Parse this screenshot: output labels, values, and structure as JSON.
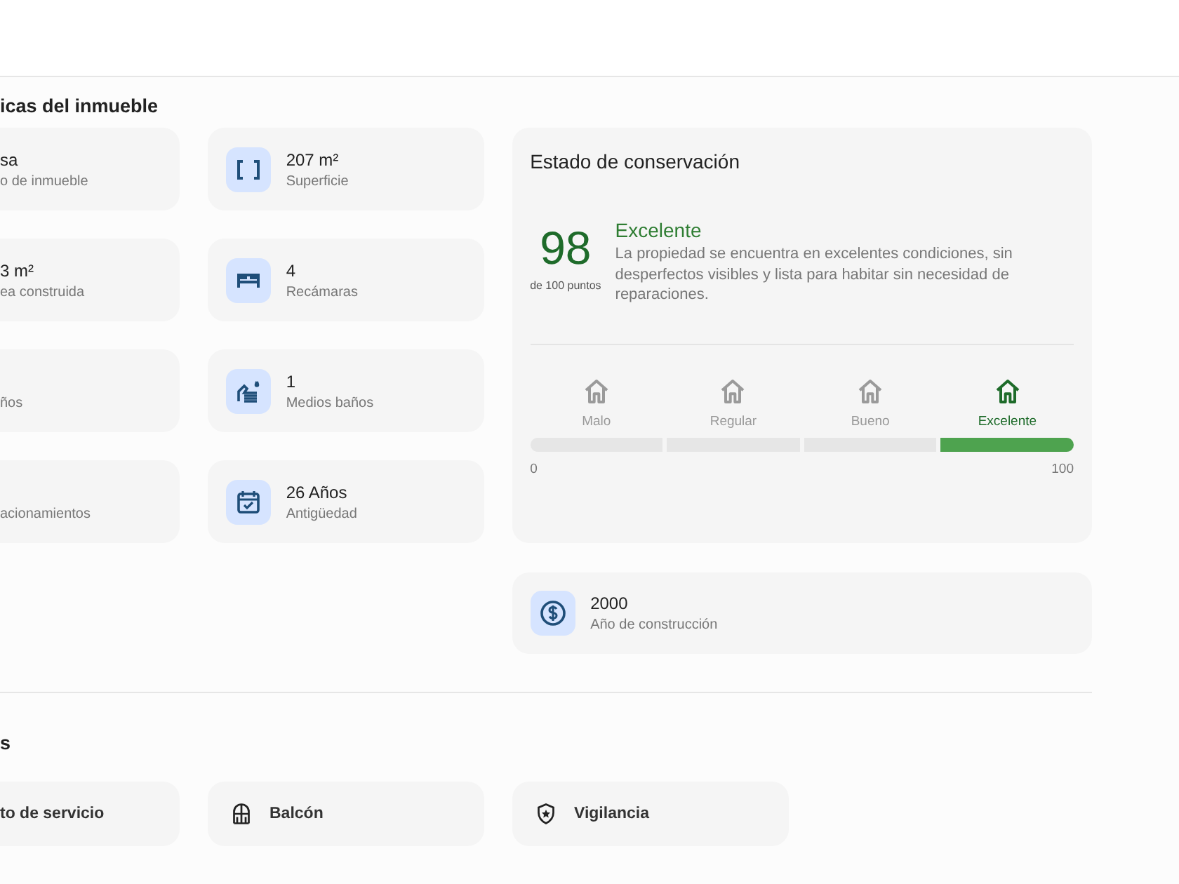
{
  "characteristics": {
    "title": "icas del inmueble",
    "items": [
      {
        "value": "sa",
        "label": "o de inmueble"
      },
      {
        "value": "3 m²",
        "label": "ea construida"
      },
      {
        "label": "ños"
      },
      {
        "label": "acionamientos"
      },
      {
        "value": "207 m²",
        "label": "Superficie"
      },
      {
        "value": "4",
        "label": "Recámaras"
      },
      {
        "value": "1",
        "label": "Medios baños"
      },
      {
        "value": "26 Años",
        "label": "Antigüedad"
      }
    ],
    "conservation": {
      "title": "Estado de conservación",
      "score": "98",
      "score_caption": "de 100 puntos",
      "rating": "Excelente",
      "description": "La propiedad se encuentra en excelentes condiciones, sin desperfectos visibles y lista para habitar sin necesidad de reparaciones.",
      "levels": [
        {
          "label": "Malo",
          "selected": false
        },
        {
          "label": "Regular",
          "selected": false
        },
        {
          "label": "Bueno",
          "selected": false
        },
        {
          "label": "Excelente",
          "selected": true
        }
      ],
      "scale_min": "0",
      "scale_max": "100"
    },
    "year_item": {
      "value": "2000",
      "label": "Año de construcción"
    }
  },
  "amenities": {
    "title": "s",
    "items": [
      {
        "label": "to de servicio"
      },
      {
        "label": "Balcón"
      },
      {
        "label": "Vigilancia"
      }
    ]
  }
}
